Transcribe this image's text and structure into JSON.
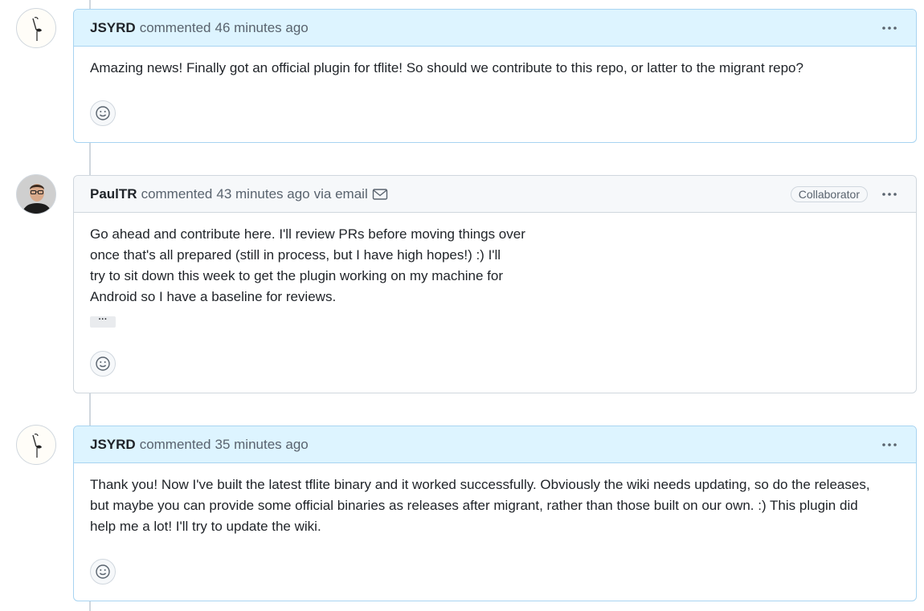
{
  "comments": [
    {
      "username": "JSYRD",
      "action": "commented",
      "timestamp": "46 minutes ago",
      "body": [
        "Amazing news! Finally got an official plugin for tflite! So should we contribute to this repo, or latter to the migrant repo?"
      ]
    },
    {
      "username": "PaulTR",
      "action": "commented",
      "timestamp": "43 minutes ago",
      "via": "via email",
      "role": "Collaborator",
      "body": [
        "Go ahead and contribute here. I'll review PRs before moving things over",
        "once that's all prepared (still in process, but I have high hopes!) :) I'll",
        "try to sit down this week to get the plugin working on my machine for",
        "Android so I have a baseline for reviews."
      ],
      "hidden_text_toggle": "···"
    },
    {
      "username": "JSYRD",
      "action": "commented",
      "timestamp": "35 minutes ago",
      "body": [
        "Thank you! Now I've built the latest tflite binary and it worked successfully. Obviously the wiki needs updating, so do the releases,",
        "but maybe you can provide some official binaries as releases after migrant, rather than those built on our own. :) This plugin did",
        "help me a lot! I'll try to update the wiki."
      ]
    }
  ],
  "colors": {
    "author_header_bg": "#ddf4ff",
    "author_border": "#a8d4f1",
    "default_header_bg": "#f6f8fa",
    "border": "#d0d7de",
    "muted_text": "#59636e"
  },
  "icons": {
    "menu": "kebab-horizontal-icon",
    "reaction": "smiley-icon",
    "email": "mail-icon"
  }
}
